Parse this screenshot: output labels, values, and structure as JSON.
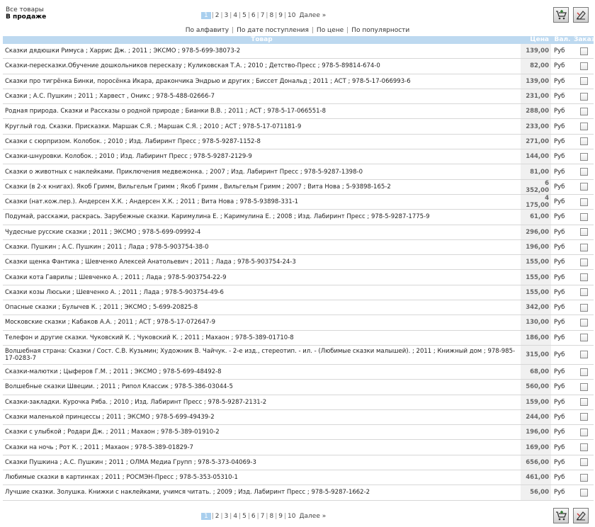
{
  "header": {
    "all_goods": "Все товары",
    "current": "В продаже"
  },
  "pager": {
    "pages": [
      "1",
      "2",
      "3",
      "4",
      "5",
      "6",
      "7",
      "8",
      "9",
      "10"
    ],
    "active": "1",
    "next": "Далее »"
  },
  "sort": {
    "alpha": "По алфавиту",
    "date": "По дате поступления",
    "price": "По цене",
    "popular": "По популярности"
  },
  "table": {
    "columns": {
      "title": "Товар",
      "price": "Цена",
      "currency": "Вал.",
      "order": "Заказ"
    },
    "rows": [
      {
        "title": "Сказки дядюшки Римуса ; Харрис Дж. ; 2011 ; ЭКСМО ; 978-5-699-38073-2",
        "price": "139,00",
        "cur": "Руб"
      },
      {
        "title": "Сказки-пересказки.Обучение дошкольников пересказу ; Куликовская Т.А. ; 2010 ; Детство-Пресс ; 978-5-89814-674-0",
        "price": "82,00",
        "cur": "Руб"
      },
      {
        "title": "Сказки про тигрёнка Бинки, поросёнка Икара, дракончика Эндрью и других ; Биссет Дональд ; 2011 ; АСТ ; 978-5-17-066993-6",
        "price": "139,00",
        "cur": "Руб"
      },
      {
        "title": "Сказки ; А.С. Пушкин ; 2011 ; Харвест , Оникс ; 978-5-488-02666-7",
        "price": "231,00",
        "cur": "Руб"
      },
      {
        "title": "Родная природа. Сказки и Рассказы о родной природе ; Бианки В.В. ; 2011 ; АСТ ; 978-5-17-066551-8",
        "price": "288,00",
        "cur": "Руб"
      },
      {
        "title": "Круглый год. Сказки. Присказки. Маршак С.Я. ; Маршак С.Я. ; 2010 ; АСТ ; 978-5-17-071181-9",
        "price": "233,00",
        "cur": "Руб"
      },
      {
        "title": "Сказки с сюрпризом. Колобок. ; 2010 ; Изд. Лабиринт Пресс ; 978-5-9287-1152-8",
        "price": "271,00",
        "cur": "Руб"
      },
      {
        "title": "Сказки-шнуровки. Колобок. ; 2010 ; Изд. Лабиринт Пресс ; 978-5-9287-2129-9",
        "price": "144,00",
        "cur": "Руб"
      },
      {
        "title": "Сказки о животных с наклейками. Приключения медвежонка. ; 2007 ; Изд. Лабиринт Пресс ; 978-5-9287-1398-0",
        "price": "81,00",
        "cur": "Руб"
      },
      {
        "title": "Сказки (в 2-х книгах). Якоб Гримм, Вильгельм Гримм ; Якоб Гримм , Вильгельм Гримм ; 2007 ; Вита Нова ; 5-93898-165-2",
        "price": "6 352,00",
        "cur": "Руб"
      },
      {
        "title": "Сказки (нат.кож.пер.). Андерсен Х.К. ; Андерсен Х.К. ; 2011 ; Вита Нова ; 978-5-93898-331-1",
        "price": "4 175,00",
        "cur": "Руб"
      },
      {
        "title": "Подумай, расскажи, раскрась. Зарубежные сказки. Каримулина Е. ; Каримулина Е. ; 2008 ; Изд. Лабиринт Пресс ; 978-5-9287-1775-9",
        "price": "61,00",
        "cur": "Руб"
      },
      {
        "title": "Чудесные русские сказки ; 2011 ; ЭКСМО ; 978-5-699-09992-4",
        "price": "296,00",
        "cur": "Руб"
      },
      {
        "title": "Сказки. Пушкин ; А.С. Пушкин ; 2011 ; Лада ; 978-5-903754-38-0",
        "price": "196,00",
        "cur": "Руб"
      },
      {
        "title": "Сказки щенка Фантика ; Шевченко Алексей Анатольевич ; 2011 ; Лада ; 978-5-903754-24-3",
        "price": "155,00",
        "cur": "Руб"
      },
      {
        "title": "Сказки кота Гаврилы ; Шевченко А. ; 2011 ; Лада ; 978-5-903754-22-9",
        "price": "155,00",
        "cur": "Руб"
      },
      {
        "title": "Сказки козы Люськи ; Шевченко А. ; 2011 ; Лада ; 978-5-903754-49-6",
        "price": "155,00",
        "cur": "Руб"
      },
      {
        "title": "Опасные сказки ; Булычев К. ; 2011 ; ЭКСМО ; 5-699-20825-8",
        "price": "342,00",
        "cur": "Руб"
      },
      {
        "title": "Московские сказки ; Кабаков А.А. ; 2011 ; АСТ ; 978-5-17-072647-9",
        "price": "130,00",
        "cur": "Руб"
      },
      {
        "title": "Телефон и другие сказки. Чуковский К. ; Чуковский К. ; 2011 ; Махаон ; 978-5-389-01710-8",
        "price": "186,00",
        "cur": "Руб"
      },
      {
        "title": "Волшебная страна: Сказки / Сост. С.В. Кузьмин; Художник В. Чайчук. - 2-е изд., стереотип. - ил. - (Любимые сказки малышей). ; 2011 ; Книжный дом ; 978-985-17-0283-7",
        "price": "315,00",
        "cur": "Руб",
        "tall": true
      },
      {
        "title": "Сказки-малютки ; Цыферов Г.М. ; 2011 ; ЭКСМО ; 978-5-699-48492-8",
        "price": "68,00",
        "cur": "Руб"
      },
      {
        "title": "Волшебные сказки Швеции. ; 2011 ; Рипол Классик ; 978-5-386-03044-5",
        "price": "560,00",
        "cur": "Руб"
      },
      {
        "title": "Сказки-закладки. Курочка Ряба. ; 2010 ; Изд. Лабиринт Пресс ; 978-5-9287-2131-2",
        "price": "159,00",
        "cur": "Руб"
      },
      {
        "title": "Сказки маленькой принцессы ; 2011 ; ЭКСМО ; 978-5-699-49439-2",
        "price": "244,00",
        "cur": "Руб"
      },
      {
        "title": "Сказки с улыбкой ; Родари Дж. ; 2011 ; Махаон ; 978-5-389-01910-2",
        "price": "196,00",
        "cur": "Руб"
      },
      {
        "title": "Сказки на ночь ; Рот К. ; 2011 ; Махаон ; 978-5-389-01829-7",
        "price": "169,00",
        "cur": "Руб"
      },
      {
        "title": "Сказки Пушкина ; А.С. Пушкин ; 2011 ; ОЛМА Медиа Групп ; 978-5-373-04069-3",
        "price": "656,00",
        "cur": "Руб"
      },
      {
        "title": "Любимые сказки в картинках ; 2011 ; РОСМЭН-Пресс ; 978-5-353-05310-1",
        "price": "461,00",
        "cur": "Руб"
      },
      {
        "title": "Лучшие сказки. Золушка. Книжки с наклейками, учимся читать. ; 2009 ; Изд. Лабиринт Пресс ; 978-5-9287-1662-2",
        "price": "56,00",
        "cur": "Руб"
      }
    ]
  },
  "icons": {
    "cart": "cart-add-icon",
    "clear": "clear-order-icon"
  },
  "colors": {
    "header_bg": "#bdd9f0",
    "pager_active": "#a9cfee",
    "price_bg": "#f0f0f0"
  }
}
